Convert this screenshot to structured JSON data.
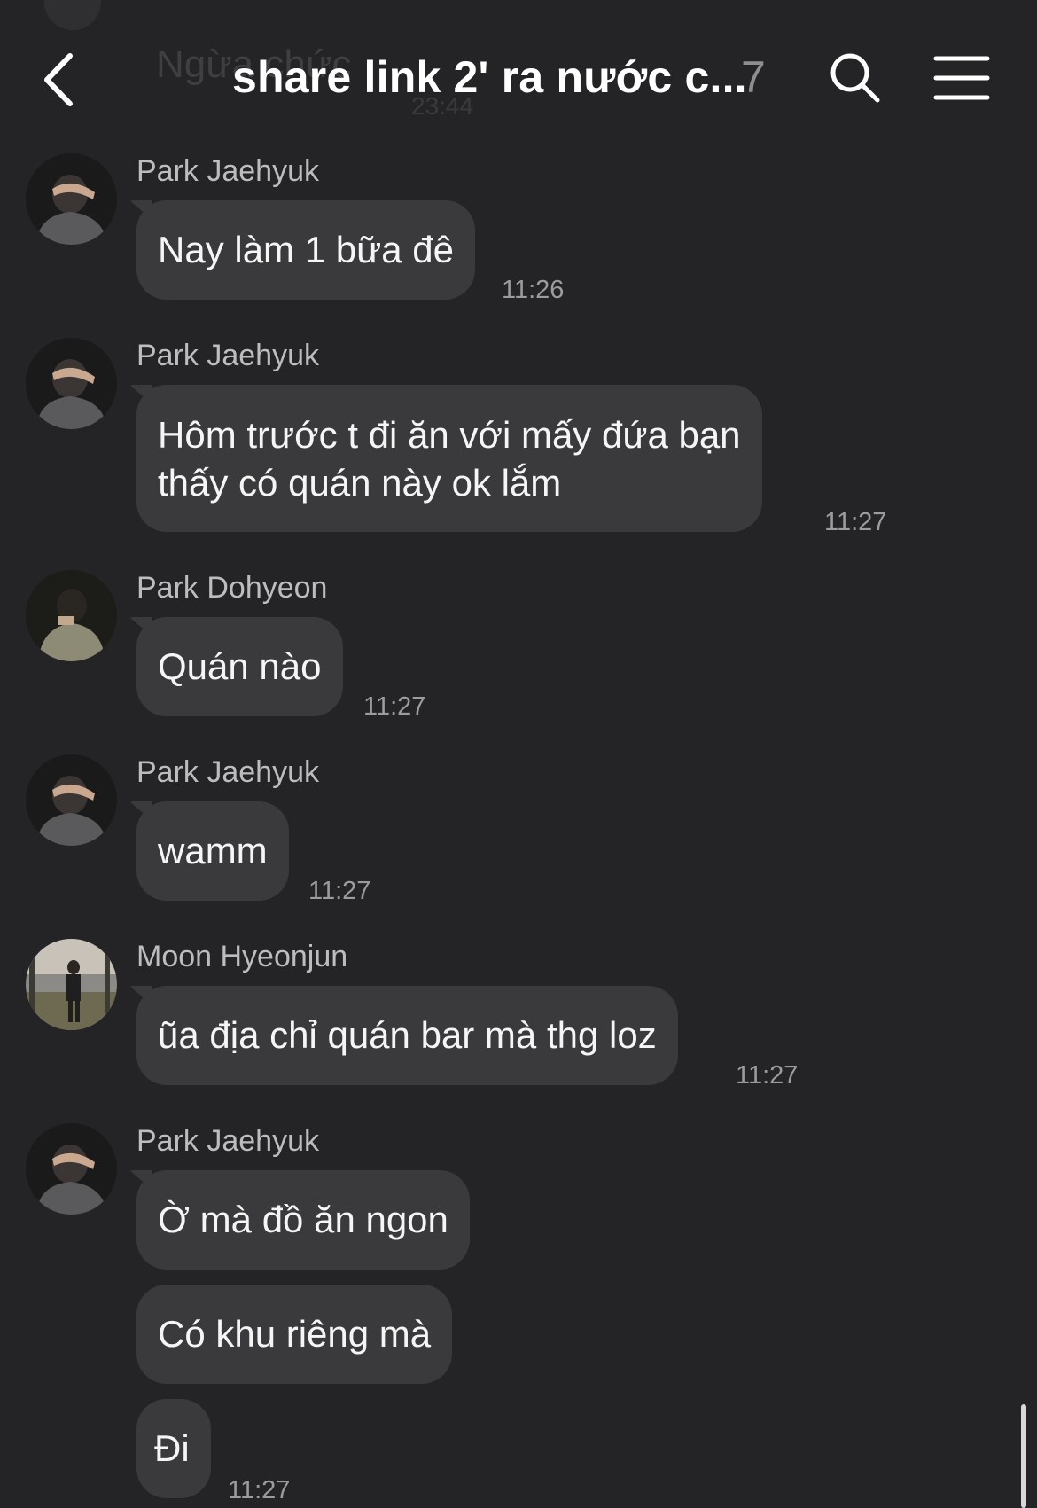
{
  "header": {
    "ghost_text": "Ngừa chức",
    "ghost_time": "23:44",
    "title": "share link 2' ra nước c...",
    "member_count": "7",
    "icons": [
      "back-chevron-icon",
      "search-icon",
      "menu-icon"
    ]
  },
  "messages": [
    {
      "sender": "Park Jaehyuk",
      "lines": [
        "Nay làm 1 bữa đê"
      ],
      "time": "11:26"
    },
    {
      "sender": "Park Jaehyuk",
      "lines": [
        "Hôm trước t đi ăn với mấy đứa bạn",
        "thấy có quán này ok lắm"
      ],
      "time": "11:27"
    },
    {
      "sender": "Park Dohyeon",
      "lines": [
        "Quán nào"
      ],
      "time": "11:27"
    },
    {
      "sender": "Park Jaehyuk",
      "lines": [
        "wamm"
      ],
      "time": "11:27"
    },
    {
      "sender": "Moon Hyeonjun",
      "lines": [
        "ũa địa chỉ quán bar mà thg loz"
      ],
      "time": "11:27"
    },
    {
      "sender": "Park Jaehyuk",
      "bubbles": [
        "Ờ mà đồ ăn ngon",
        "Có khu riêng mà",
        "Đi"
      ],
      "time": "11:27"
    }
  ],
  "colors": {
    "background": "#242426",
    "bubble": "#3a3a3c",
    "name": "#bdbdbf",
    "time": "#9c9c9e"
  }
}
